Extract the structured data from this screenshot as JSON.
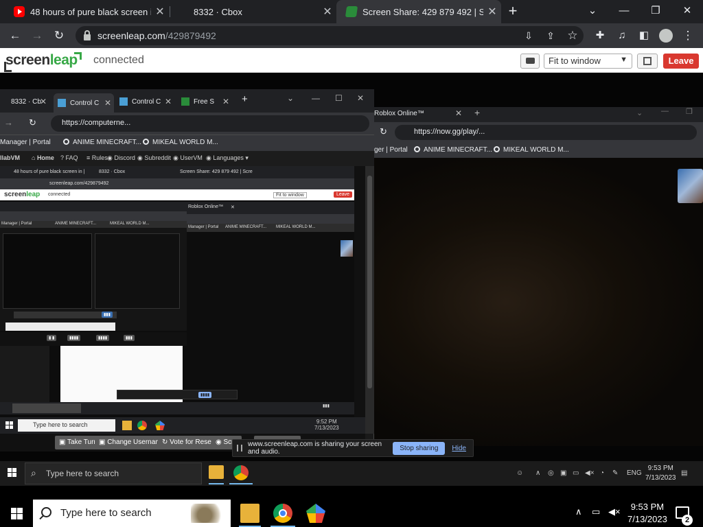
{
  "browser": {
    "tabs": [
      {
        "title": "48 hours of pure black screen in |"
      },
      {
        "title": "8332 · Cbox"
      },
      {
        "title": "Screen Share: 429 879 492 | Scre"
      }
    ],
    "url_domain": "screenleap.com",
    "url_path": "/429879492"
  },
  "screenleap": {
    "logo_screen": "screen",
    "logo_leap": "leap",
    "status": "connected",
    "view_mode": "Fit to window",
    "leave_label": "Leave"
  },
  "remote": {
    "left_browser": {
      "tabs": [
        "8332 · Cb",
        "Control C",
        "Control C",
        "Free S"
      ],
      "url": "https://computerne...",
      "bookmarks": [
        "Manager | Portal",
        "ANIME MINECRAFT...",
        "MIKEAL WORLD M..."
      ],
      "site_nav": [
        "llabVM",
        "Home",
        "FAQ",
        "Rules",
        "Discord",
        "Subreddit",
        "UserVM",
        "Languages"
      ],
      "nested_url": "screenleap.com/429879492",
      "nested_status": "connected",
      "nested_view_mode": "Fit to window",
      "nested_leave": "Leave",
      "nested_tab_roblox": "Roblox Online™",
      "nested_bm": [
        "Manager | Portal",
        "ANIME MINECRAFT...",
        "MIKEAL WORLD M..."
      ],
      "controls": [
        "Take Turn",
        "Change Username",
        "Vote for Reset",
        "Scre"
      ],
      "inner_search": "Type here to search",
      "inner_time": "9:52 PM",
      "inner_date": "7/13/2023"
    },
    "right_browser": {
      "tab_title": "Roblox Online™",
      "url": "https://now.gg/play/...",
      "bookmarks": [
        "ger | Portal",
        "ANIME MINECRAFT...",
        "MIKEAL WORLD M..."
      ]
    },
    "share_bar": {
      "message": "www.screenleap.com is sharing your screen and audio.",
      "stop": "Stop sharing",
      "hide": "Hide"
    },
    "taskbar": {
      "search": "Type here to search",
      "lang": "ENG",
      "time": "9:53 PM",
      "date": "7/13/2023"
    }
  },
  "taskbar": {
    "search_placeholder": "Type here to search",
    "time": "9:53 PM",
    "date": "7/13/2023",
    "notifications": "2"
  },
  "colors": {
    "leave": "#d9382f",
    "logo_green": "#37a846",
    "stop_sharing": "#8ab4f8"
  }
}
